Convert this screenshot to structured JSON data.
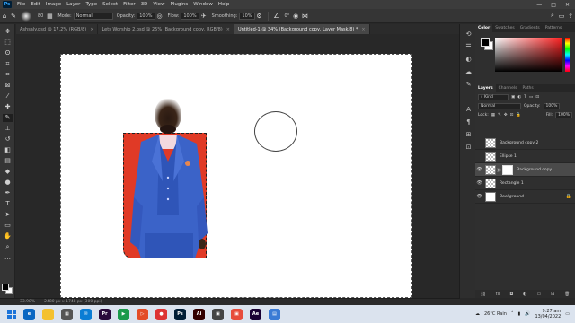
{
  "menubar": {
    "logo": "Ps",
    "items": [
      "File",
      "Edit",
      "Image",
      "Layer",
      "Type",
      "Select",
      "Filter",
      "3D",
      "View",
      "Plugins",
      "Window",
      "Help"
    ],
    "window_controls": [
      "—",
      "□",
      "✕"
    ]
  },
  "options": {
    "mode_label": "Mode:",
    "mode_value": "Normal",
    "opacity_label": "Opacity:",
    "opacity_value": "100%",
    "flow_label": "Flow:",
    "flow_value": "100%",
    "smoothing_label": "Smoothing:",
    "smoothing_value": "10%",
    "brush_size": "80",
    "angle": "0°"
  },
  "tabs": [
    {
      "label": "Ashsaly.psd @ 17.2% (RGB/8)",
      "close": "×",
      "active": false
    },
    {
      "label": "Lets Worship 2.psd @ 25% (Background copy, RGB/8)",
      "close": "×",
      "active": false
    },
    {
      "label": "Untitled-1 @ 34% (Background copy, Layer Mask/8) *",
      "close": "×",
      "active": true
    }
  ],
  "status": {
    "zoom": "33.98%",
    "doc_size": "2480 px x 1748 px (300 ppi)"
  },
  "color_panel": {
    "tabs": [
      "Color",
      "Swatches",
      "Gradients",
      "Patterns"
    ]
  },
  "layers_panel": {
    "tabs": [
      "Layers",
      "Channels",
      "Paths"
    ],
    "kind_label": "Kind",
    "blend_mode": "Normal",
    "opacity_label": "Opacity:",
    "opacity_value": "100%",
    "lock_label": "Lock:",
    "fill_label": "Fill:",
    "fill_value": "100%",
    "layers": [
      {
        "name": "Background copy 2",
        "selected": false,
        "visible": false
      },
      {
        "name": "Ellipse 1",
        "selected": false,
        "visible": false
      },
      {
        "name": "Background copy",
        "selected": true,
        "visible": true
      },
      {
        "name": "Rectangle 1",
        "selected": false,
        "visible": true
      },
      {
        "name": "Background",
        "selected": false,
        "visible": true
      }
    ]
  },
  "taskbar": {
    "weather": "26°C  Rain",
    "time": "9:27 am",
    "date": "13/04/2022",
    "app_icons": [
      {
        "name": "Ps",
        "color": "#001e36"
      },
      {
        "name": "Pr",
        "color": "#2a0a3a"
      },
      {
        "name": "Ai",
        "color": "#330000"
      },
      {
        "name": "Ae",
        "color": "#1a0033"
      }
    ]
  },
  "colors": {
    "accent_red": "#e03a26",
    "suit_blue": "#3b63c8",
    "panel_bg": "#2f2f2f"
  }
}
